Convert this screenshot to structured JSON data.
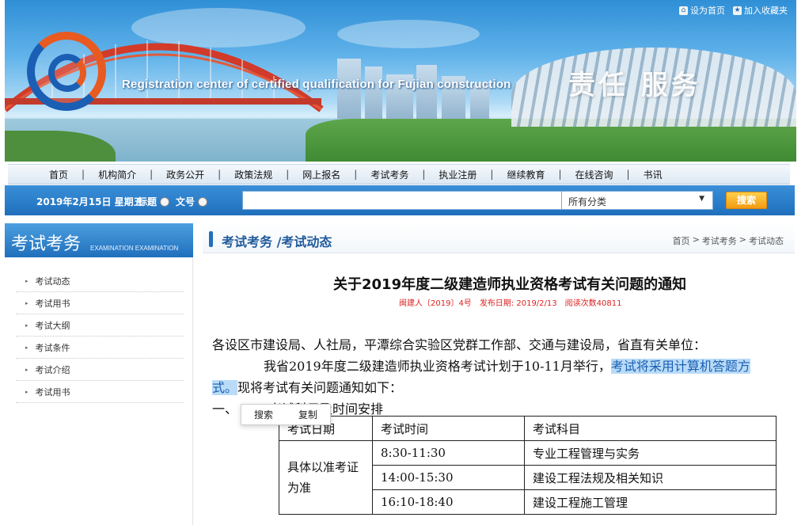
{
  "banner": {
    "english_title": "Registration center of certified qualification for Fujian construction",
    "slogan": "责任  服务",
    "links": [
      {
        "label": "设为首页",
        "icon": "home-icon"
      },
      {
        "label": "加入收藏夹",
        "icon": "bookmark-icon"
      }
    ]
  },
  "nav": {
    "items": [
      "首页",
      "机构简介",
      "政务公开",
      "政策法规",
      "网上报名",
      "考试考务",
      "执业注册",
      "继续教育",
      "在线咨询",
      "书讯"
    ],
    "separator": "|"
  },
  "search": {
    "date": "2019年2月15日 星期五",
    "radio_title": "标题",
    "radio_docno": "文号",
    "keyword_value": "",
    "category_selected": "所有分类",
    "button_label": "搜索"
  },
  "sidebar": {
    "title": "考试考务",
    "title_en": "EXAMINATION EXAMINATION",
    "items": [
      "考试动态",
      "考试用书",
      "考试大纲",
      "考试条件",
      "考试介绍",
      "考试用书"
    ]
  },
  "main": {
    "section_title": "考试考务 /考试动态",
    "breadcrumb": [
      "首页",
      ">",
      "考试考务",
      ">",
      "考试动态"
    ]
  },
  "article": {
    "title": "关于2019年度二级建造师执业资格考试有关问题的通知",
    "doc_no": "闽建人〔2019〕4号",
    "publish_date": "发布日期: 2019/2/13",
    "read_count": "阅读次数40811",
    "addressee": "各设区市建设局、人社局，平潭综合实验区党群工作部、交通与建设局，省直有关单位：",
    "para1_a": "我省2019年度二级建造师执业资格考试计划于10-11月举行，",
    "para1_highlight": "考试将采用计算机答题方",
    "para1_highlight_2": "式。",
    "para1_b": "现将考试有关问题通知如下：",
    "section1_prefix": "一、",
    "section1_tail": "考试科目及时间安排"
  },
  "popup": {
    "search": "搜索",
    "copy": "复制"
  },
  "schedule": {
    "headers": [
      "考试日期",
      "考试时间",
      "考试科目"
    ],
    "date_cell": "具体以准考证为准",
    "rows": [
      {
        "time": "8:30-11:30",
        "subject": "专业工程管理与实务"
      },
      {
        "time": "14:00-15:30",
        "subject": "建设工程法规及相关知识"
      },
      {
        "time": "16:10-18:40",
        "subject": "建设工程施工管理"
      }
    ]
  }
}
